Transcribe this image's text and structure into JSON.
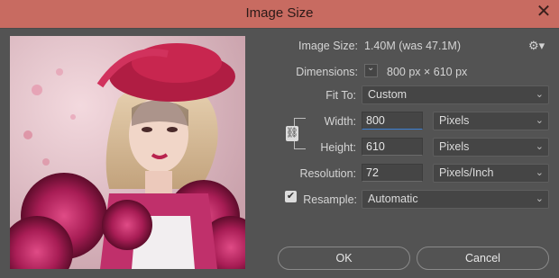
{
  "window": {
    "title": "Image Size",
    "close_glyph": "✕"
  },
  "info": {
    "image_size_label": "Image Size:",
    "image_size_value": "1.40M (was 47.1M)",
    "dimensions_label": "Dimensions:",
    "dimensions_value": "800 px  ×  610 px",
    "gear_glyph": "⚙▾"
  },
  "fit_to": {
    "label": "Fit To:",
    "value": "Custom"
  },
  "width": {
    "label": "Width:",
    "value": "800",
    "unit": "Pixels"
  },
  "height": {
    "label": "Height:",
    "value": "610",
    "unit": "Pixels"
  },
  "resolution": {
    "label": "Resolution:",
    "value": "72",
    "unit": "Pixels/Inch"
  },
  "resample": {
    "label": "Resample:",
    "checked": true,
    "value": "Automatic"
  },
  "buttons": {
    "ok": "OK",
    "cancel": "Cancel"
  },
  "colors": {
    "titlebar": "#c86b61",
    "panel": "#535353",
    "accent": "#3b7fd4"
  }
}
